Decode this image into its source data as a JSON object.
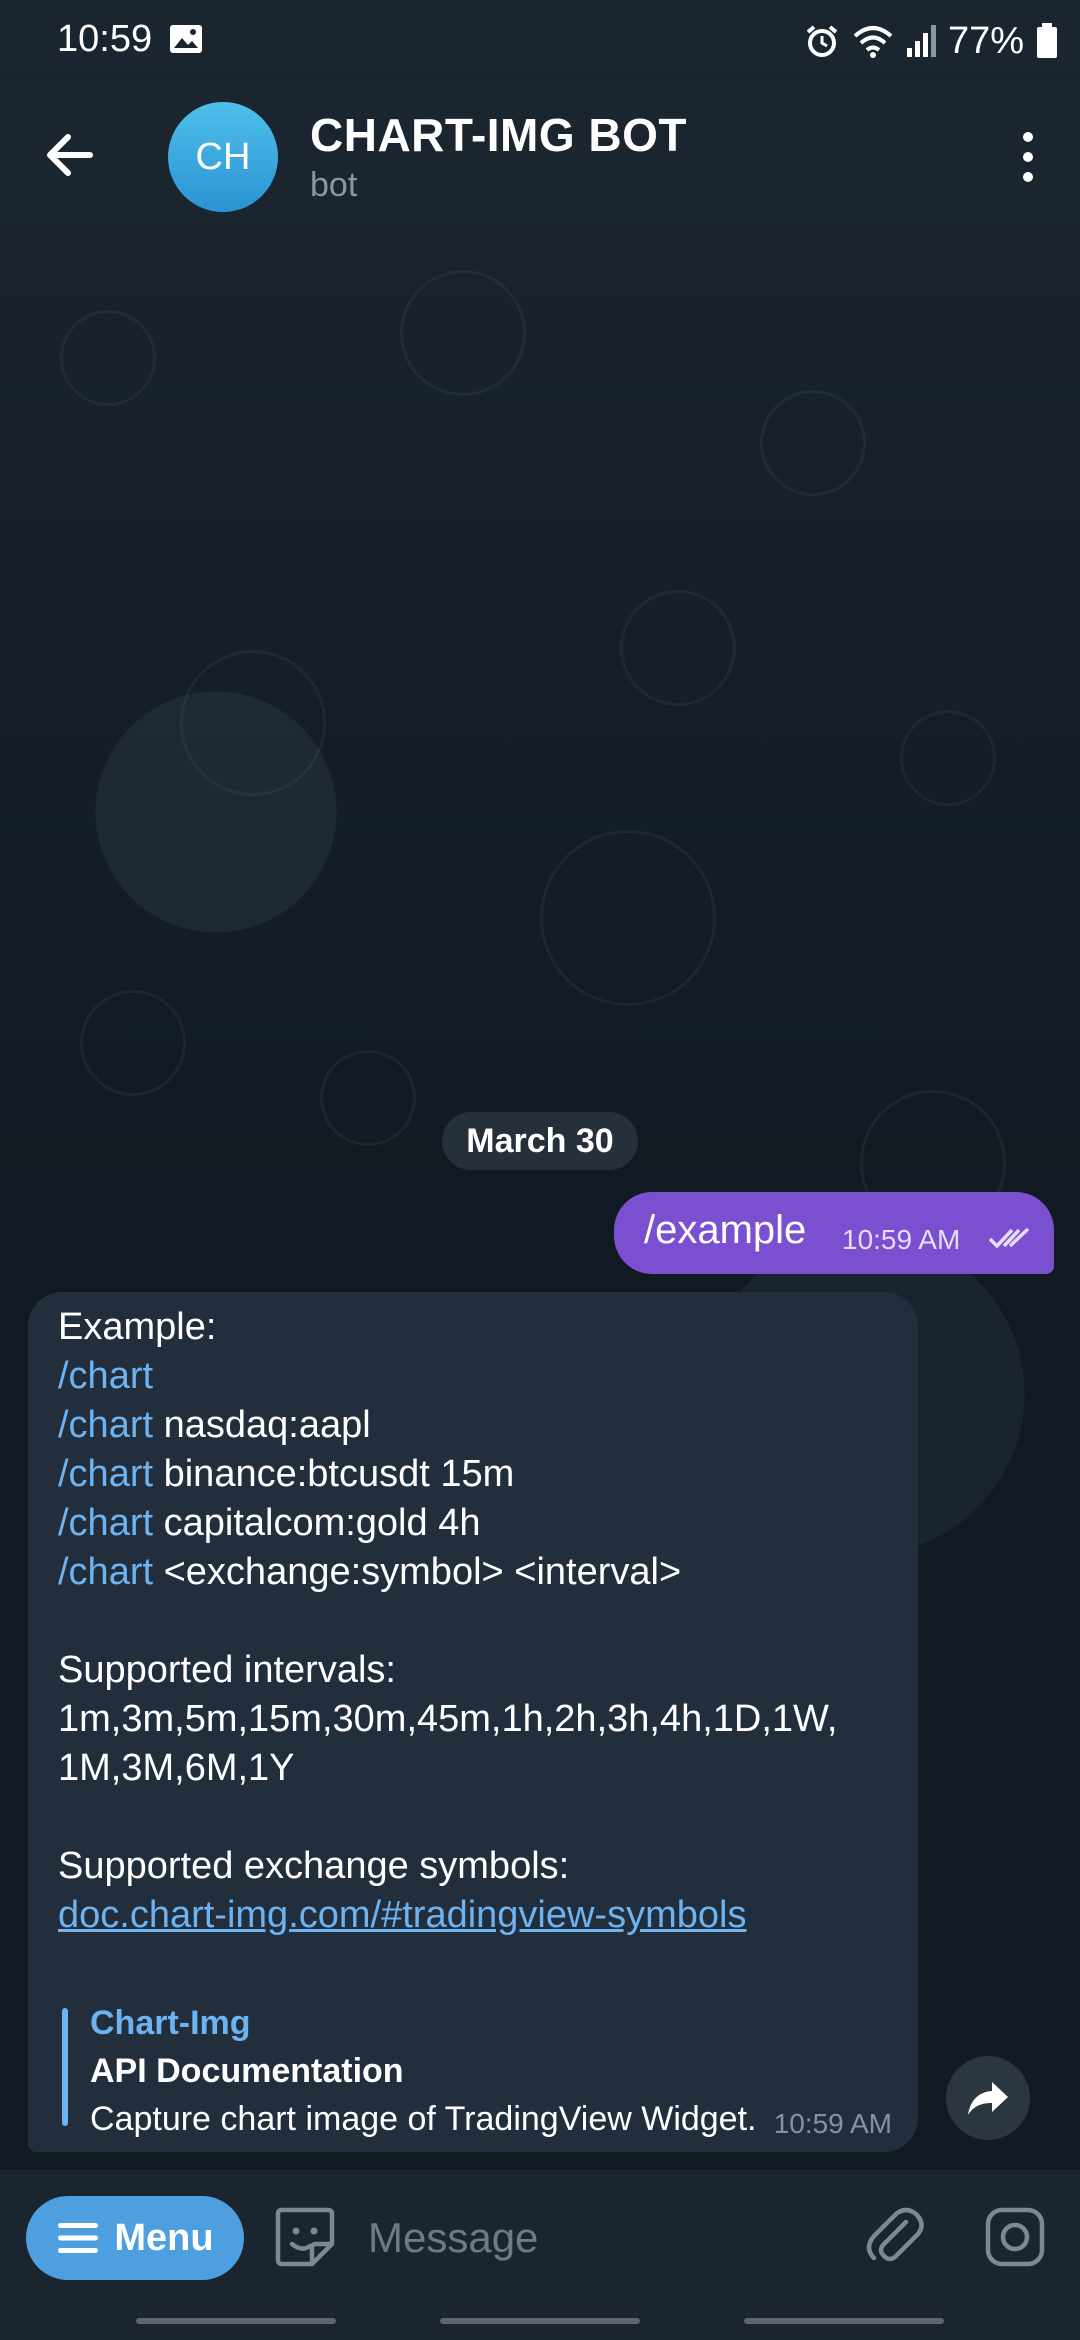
{
  "status_bar": {
    "time": "10:59",
    "battery": "77%"
  },
  "header": {
    "avatar_initials": "CH",
    "title": "CHART-IMG BOT",
    "subtitle": "bot"
  },
  "chat": {
    "date_label": "March 30",
    "outgoing": {
      "text": "/example",
      "time": "10:59 AM"
    },
    "incoming": {
      "lines": [
        {
          "cmd": "",
          "text": "Example:"
        },
        {
          "cmd": "/chart",
          "text": ""
        },
        {
          "cmd": "/chart",
          "text": " nasdaq:aapl"
        },
        {
          "cmd": "/chart",
          "text": " binance:btcusdt 15m"
        },
        {
          "cmd": "/chart",
          "text": " capitalcom:gold 4h"
        },
        {
          "cmd": "/chart",
          "text": " <exchange:symbol> <interval>"
        }
      ],
      "intervals_label": "Supported intervals:",
      "intervals_line1": "1m,3m,5m,15m,30m,45m,1h,2h,3h,4h,1D,1W,",
      "intervals_line2": "1M,3M,6M,1Y",
      "symbols_label": "Supported exchange symbols:",
      "symbols_link": "doc.chart-img.com/#tradingview-symbols",
      "preview": {
        "site": "Chart-Img",
        "title": "API Documentation",
        "description": "Capture chart image of TradingView Widget."
      },
      "time": "10:59 AM"
    }
  },
  "input_bar": {
    "menu_label": "Menu",
    "message_placeholder": "Message"
  },
  "colors": {
    "outgoing_bubble": "#7a4fd0",
    "incoming_bubble": "#222e3b",
    "accent_link": "#6db3f2",
    "menu_button": "#4e9fe0"
  },
  "icons": [
    "back-arrow-icon",
    "more-vert-icon",
    "double-check-icon",
    "share-icon",
    "menu-lines-icon",
    "sticker-icon",
    "attach-icon",
    "camera-icon",
    "alarm-icon",
    "wifi-icon",
    "signal-icon",
    "battery-icon",
    "image-icon"
  ]
}
